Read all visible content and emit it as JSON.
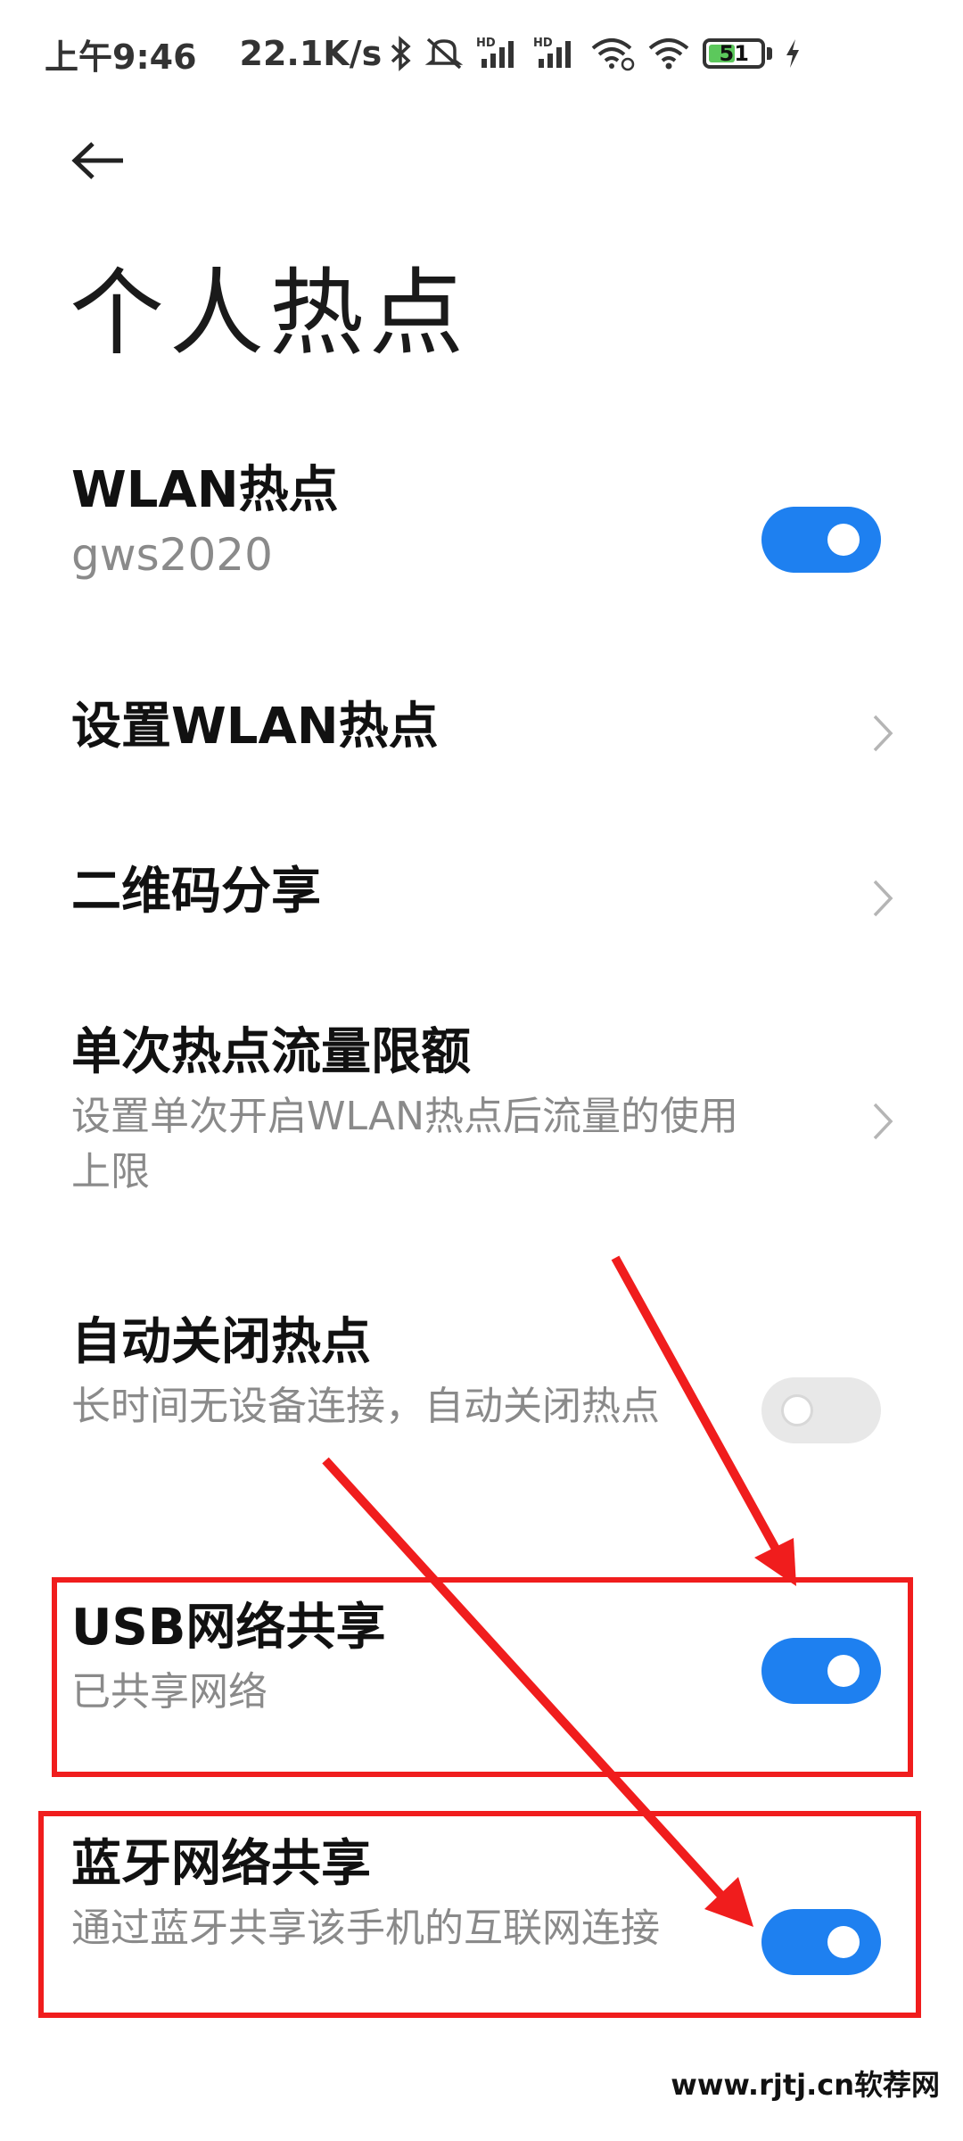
{
  "status_bar": {
    "time": "上午9:46",
    "speed": "22.1K/s",
    "battery": "51",
    "battery_fraction": 0.51,
    "icons": [
      "bluetooth-icon",
      "mute-icon",
      "signal-hd-icon",
      "signal-hd-icon",
      "wifi-link-icon",
      "wifi-icon",
      "battery-icon",
      "charging-icon"
    ],
    "hd_label": "HD"
  },
  "header": {
    "title": "个人热点"
  },
  "items": {
    "wlan_hotspot": {
      "title": "WLAN热点",
      "subtitle": "gws2020",
      "enabled": true
    },
    "setup_wlan": {
      "title": "设置WLAN热点"
    },
    "qr_share": {
      "title": "二维码分享"
    },
    "data_limit": {
      "title": "单次热点流量限额",
      "subtitle": "设置单次开启WLAN热点后流量的使用上限"
    },
    "auto_close": {
      "title": "自动关闭热点",
      "subtitle": "长时间无设备连接，自动关闭热点",
      "enabled": false
    },
    "usb_tether": {
      "title": "USB网络共享",
      "subtitle": "已共享网络",
      "enabled": true
    },
    "bt_tether": {
      "title": "蓝牙网络共享",
      "subtitle": "通过蓝牙共享该手机的互联网连接",
      "enabled": true
    }
  },
  "watermark": "www.rjtj.cn软荐网",
  "colors": {
    "toggle_on": "#1e80f0",
    "annotation": "#f01d1d"
  }
}
